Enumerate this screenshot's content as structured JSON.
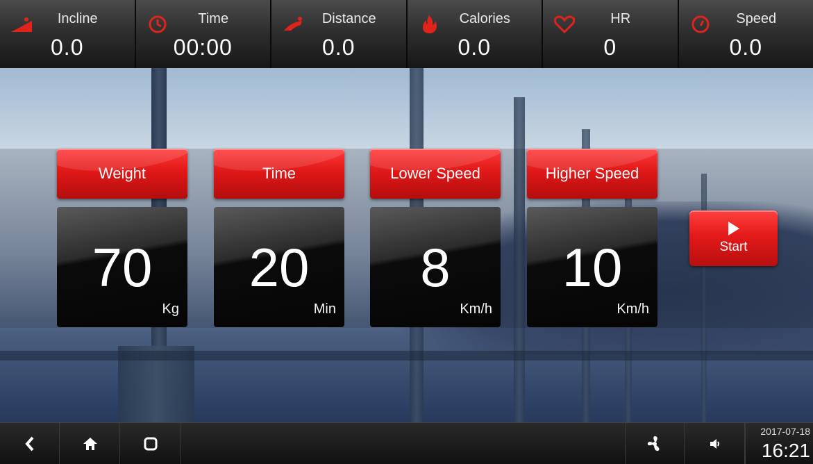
{
  "stats": [
    {
      "label": "Incline",
      "value": "0.0",
      "icon": "incline-icon"
    },
    {
      "label": "Time",
      "value": "00:00",
      "icon": "clock-icon"
    },
    {
      "label": "Distance",
      "value": "0.0",
      "icon": "runner-icon"
    },
    {
      "label": "Calories",
      "value": "0.0",
      "icon": "flame-icon"
    },
    {
      "label": "HR",
      "value": "0",
      "icon": "heart-icon"
    },
    {
      "label": "Speed",
      "value": "0.0",
      "icon": "speedometer-icon"
    }
  ],
  "params": [
    {
      "label": "Weight",
      "value": "70",
      "unit": "Kg"
    },
    {
      "label": "Time",
      "value": "20",
      "unit": "Min"
    },
    {
      "label": "Lower Speed",
      "value": "8",
      "unit": "Km/h"
    },
    {
      "label": "Higher Speed",
      "value": "10",
      "unit": "Km/h"
    }
  ],
  "start": {
    "label": "Start",
    "icon": "play-icon"
  },
  "nav": {
    "back_icon": "back-icon",
    "home_icon": "home-icon",
    "recents_icon": "recents-icon",
    "fan_icon": "fan-icon",
    "volume_icon": "volume-icon"
  },
  "clock": {
    "date": "2017-07-18",
    "time": "16:21"
  },
  "colors": {
    "accent": "#e01818",
    "bar": "#2f2f2f"
  }
}
